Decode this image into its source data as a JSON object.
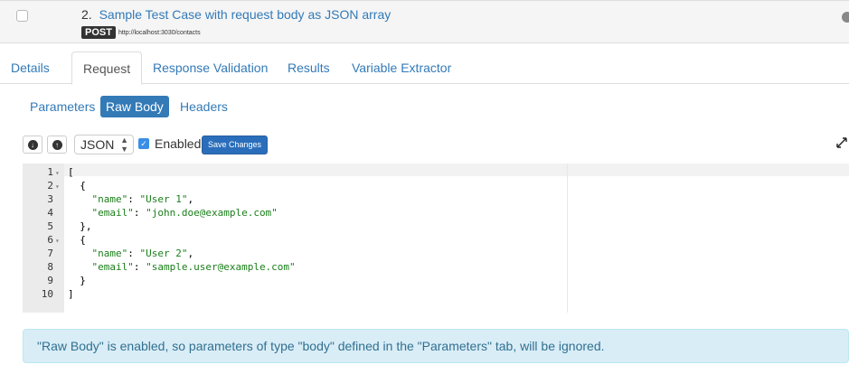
{
  "testcase": {
    "number": "2.",
    "title": "Sample Test Case with request body as JSON array",
    "method": "POST",
    "url": "http://localhost:3030/contacts"
  },
  "tabs": [
    {
      "label": "Details"
    },
    {
      "label": "Request"
    },
    {
      "label": "Response Validation"
    },
    {
      "label": "Results"
    },
    {
      "label": "Variable Extractor"
    }
  ],
  "pills": [
    {
      "label": "Parameters"
    },
    {
      "label": "Raw Body"
    },
    {
      "label": "Headers"
    }
  ],
  "toolbar": {
    "format_value": "JSON",
    "enabled_label": "Enabled",
    "save_label": "Save Changes"
  },
  "editor": {
    "lines": [
      {
        "num": "1",
        "fold": "▾",
        "code": "["
      },
      {
        "num": "2",
        "fold": "▾",
        "code": "  {"
      },
      {
        "num": "3",
        "fold": "",
        "key": "    \"name\"",
        "sep": ": ",
        "val": "\"User 1\"",
        "tail": ","
      },
      {
        "num": "4",
        "fold": "",
        "key": "    \"email\"",
        "sep": ": ",
        "val": "\"john.doe@example.com\"",
        "tail": ""
      },
      {
        "num": "5",
        "fold": "",
        "code": "  },"
      },
      {
        "num": "6",
        "fold": "▾",
        "code": "  {"
      },
      {
        "num": "7",
        "fold": "",
        "key": "    \"name\"",
        "sep": ": ",
        "val": "\"User 2\"",
        "tail": ","
      },
      {
        "num": "8",
        "fold": "",
        "key": "    \"email\"",
        "sep": ": ",
        "val": "\"sample.user@example.com\"",
        "tail": ""
      },
      {
        "num": "9",
        "fold": "",
        "code": "  }"
      },
      {
        "num": "10",
        "fold": "",
        "code": "]"
      }
    ]
  },
  "alert": {
    "text": "\"Raw Body\" is enabled, so parameters of type \"body\" defined in the \"Parameters\" tab, will be ignored."
  },
  "colors": {
    "link": "#337ab7",
    "primary_button": "#2a6ebb",
    "alert_bg": "#d9edf7",
    "alert_text": "#31708f",
    "string": "#1a7f1a"
  }
}
